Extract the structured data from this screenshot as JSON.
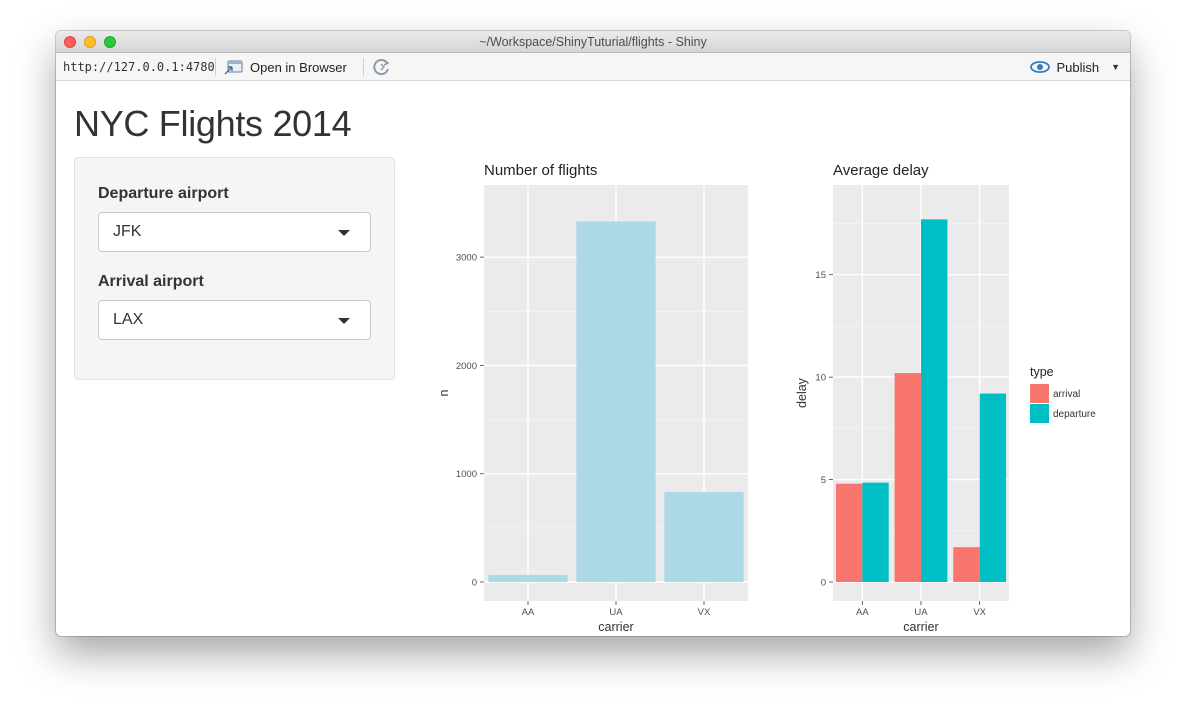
{
  "window": {
    "title": "~/Workspace/ShinyTuturial/flights - Shiny"
  },
  "toolbar": {
    "url": "http://127.0.0.1:4780",
    "open_browser_label": "Open in Browser",
    "publish_label": "Publish"
  },
  "page": {
    "title": "NYC Flights 2014",
    "departure_label": "Departure airport",
    "departure_value": "JFK",
    "arrival_label": "Arrival airport",
    "arrival_value": "LAX"
  },
  "colors": {
    "bar_flights": "#add8e6",
    "arrival": "#f8766d",
    "departure": "#00bfc4",
    "panel_bg": "#ebebeb"
  },
  "chart_data": [
    {
      "type": "bar",
      "title": "Number of flights",
      "xlabel": "carrier",
      "ylabel": "n",
      "categories": [
        "AA",
        "UA",
        "VX"
      ],
      "values": [
        65,
        3330,
        830
      ],
      "ylim": [
        0,
        3500
      ],
      "yticks": [
        0,
        1000,
        2000,
        3000
      ],
      "grid": true
    },
    {
      "type": "bar",
      "title": "Average delay",
      "xlabel": "carrier",
      "ylabel": "delay",
      "categories": [
        "AA",
        "UA",
        "VX"
      ],
      "series": [
        {
          "name": "arrival",
          "values": [
            4.8,
            10.2,
            1.7
          ]
        },
        {
          "name": "departure",
          "values": [
            4.85,
            17.7,
            9.2
          ]
        }
      ],
      "ylim": [
        0,
        18.5
      ],
      "yticks": [
        0,
        5,
        10,
        15
      ],
      "grid": true,
      "legend": {
        "title": "type",
        "placement": "right"
      }
    }
  ]
}
